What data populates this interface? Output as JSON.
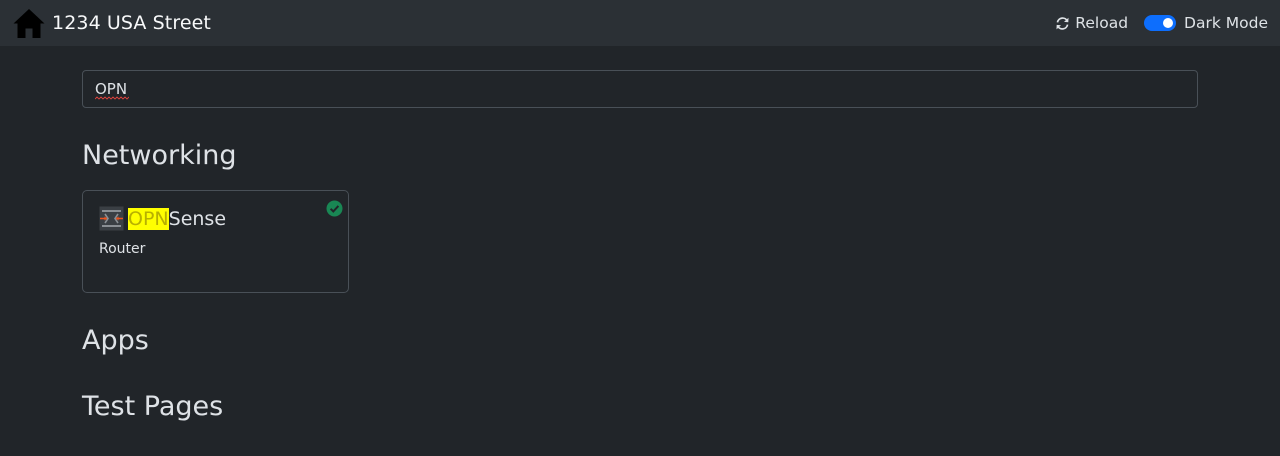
{
  "header": {
    "title": "1234 USA Street",
    "reload_label": "Reload",
    "dark_mode_label": "Dark Mode",
    "dark_mode_on": true,
    "accent_color": "#0d6efd"
  },
  "search": {
    "value": "OPN",
    "placeholder": ""
  },
  "sections": [
    {
      "title": "Networking",
      "services": [
        {
          "name_highlight": "OPN",
          "name_rest": "Sense",
          "subtitle": "Router",
          "icon": "opnsense-icon",
          "status": "online",
          "status_color": "#198754"
        }
      ]
    },
    {
      "title": "Apps",
      "services": []
    },
    {
      "title": "Test Pages",
      "services": []
    }
  ]
}
